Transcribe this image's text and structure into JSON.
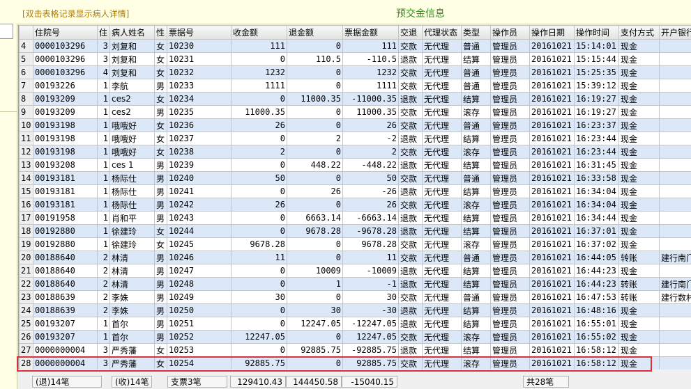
{
  "header": {
    "hint": "[双击表格记录显示病人详情]",
    "title": "预交金信息"
  },
  "columns": [
    "",
    "住院号",
    "住",
    "病人姓名",
    "性",
    "票据号",
    "收金额",
    "退金额",
    "票据金额",
    "交退",
    "代理状态",
    "类型",
    "操作员",
    "操作日期",
    "操作时间",
    "支付方式",
    "开户银行"
  ],
  "rows": [
    [
      "4",
      "0000103296",
      "3",
      "刘复和",
      "女",
      "10230",
      "111",
      "0",
      "111",
      "交款",
      "无代理",
      "普通",
      "管理员",
      "20161021",
      "15:14:01",
      "现金",
      ""
    ],
    [
      "5",
      "0000103296",
      "3",
      "刘复和",
      "女",
      "10231",
      "0",
      "110.5",
      "-110.5",
      "退款",
      "无代理",
      "结算",
      "管理员",
      "20161021",
      "15:15:44",
      "现金",
      ""
    ],
    [
      "6",
      "0000103296",
      "4",
      "刘复和",
      "女",
      "10232",
      "1232",
      "0",
      "1232",
      "交款",
      "无代理",
      "普通",
      "管理员",
      "20161021",
      "15:25:35",
      "现金",
      ""
    ],
    [
      "7",
      "00193226",
      "1",
      "李航",
      "男",
      "10233",
      "1111",
      "0",
      "1111",
      "交款",
      "无代理",
      "普通",
      "管理员",
      "20161021",
      "15:39:12",
      "现金",
      ""
    ],
    [
      "8",
      "00193209",
      "1",
      "ces2",
      "女",
      "10234",
      "0",
      "11000.35",
      "-11000.35",
      "退款",
      "无代理",
      "结算",
      "管理员",
      "20161021",
      "16:19:27",
      "现金",
      ""
    ],
    [
      "9",
      "00193209",
      "1",
      "ces2",
      "男",
      "10235",
      "11000.35",
      "0",
      "11000.35",
      "交款",
      "无代理",
      "滚存",
      "管理员",
      "20161021",
      "16:19:27",
      "现金",
      ""
    ],
    [
      "10",
      "00193198",
      "1",
      "哦哦好",
      "女",
      "10236",
      "26",
      "0",
      "26",
      "交款",
      "无代理",
      "普通",
      "管理员",
      "20161021",
      "16:23:37",
      "现金",
      ""
    ],
    [
      "11",
      "00193198",
      "1",
      "哦哦好",
      "女",
      "10237",
      "0",
      "2",
      "-2",
      "退款",
      "无代理",
      "结算",
      "管理员",
      "20161021",
      "16:23:44",
      "现金",
      ""
    ],
    [
      "12",
      "00193198",
      "1",
      "哦哦好",
      "女",
      "10238",
      "2",
      "0",
      "2",
      "交款",
      "无代理",
      "滚存",
      "管理员",
      "20161021",
      "16:23:44",
      "现金",
      ""
    ],
    [
      "13",
      "00193208",
      "1",
      "ces 1",
      "男",
      "10239",
      "0",
      "448.22",
      "-448.22",
      "退款",
      "无代理",
      "结算",
      "管理员",
      "20161021",
      "16:31:45",
      "现金",
      ""
    ],
    [
      "14",
      "00193181",
      "1",
      "杨际仕",
      "男",
      "10240",
      "50",
      "0",
      "50",
      "交款",
      "无代理",
      "普通",
      "管理员",
      "20161021",
      "16:33:58",
      "现金",
      ""
    ],
    [
      "15",
      "00193181",
      "1",
      "杨际仕",
      "男",
      "10241",
      "0",
      "26",
      "-26",
      "退款",
      "无代理",
      "结算",
      "管理员",
      "20161021",
      "16:34:04",
      "现金",
      ""
    ],
    [
      "16",
      "00193181",
      "1",
      "杨际仕",
      "男",
      "10242",
      "26",
      "0",
      "26",
      "交款",
      "无代理",
      "滚存",
      "管理员",
      "20161021",
      "16:34:04",
      "现金",
      ""
    ],
    [
      "17",
      "00191958",
      "1",
      "肖和平",
      "男",
      "10243",
      "0",
      "6663.14",
      "-6663.14",
      "退款",
      "无代理",
      "结算",
      "管理员",
      "20161021",
      "16:34:44",
      "现金",
      ""
    ],
    [
      "18",
      "00192880",
      "1",
      "徐建玲",
      "女",
      "10244",
      "0",
      "9678.28",
      "-9678.28",
      "退款",
      "无代理",
      "结算",
      "管理员",
      "20161021",
      "16:37:01",
      "现金",
      ""
    ],
    [
      "19",
      "00192880",
      "1",
      "徐建玲",
      "女",
      "10245",
      "9678.28",
      "0",
      "9678.28",
      "交款",
      "无代理",
      "滚存",
      "管理员",
      "20161021",
      "16:37:02",
      "现金",
      ""
    ],
    [
      "20",
      "00188640",
      "2",
      "林清",
      "男",
      "10246",
      "11",
      "0",
      "11",
      "交款",
      "无代理",
      "普通",
      "管理员",
      "20161021",
      "16:44:05",
      "转账",
      "建行南门"
    ],
    [
      "21",
      "00188640",
      "2",
      "林清",
      "男",
      "10247",
      "0",
      "10009",
      "-10009",
      "退款",
      "无代理",
      "结算",
      "管理员",
      "20161021",
      "16:44:23",
      "现金",
      ""
    ],
    [
      "22",
      "00188640",
      "2",
      "林清",
      "男",
      "10248",
      "0",
      "1",
      "-1",
      "退款",
      "无代理",
      "结算",
      "管理员",
      "20161021",
      "16:44:23",
      "转账",
      "建行南门"
    ],
    [
      "23",
      "00188639",
      "2",
      "李姝",
      "男",
      "10249",
      "30",
      "0",
      "30",
      "交款",
      "无代理",
      "普通",
      "管理员",
      "20161021",
      "16:47:53",
      "转账",
      "建行数村"
    ],
    [
      "24",
      "00188639",
      "2",
      "李姝",
      "男",
      "10250",
      "0",
      "30",
      "-30",
      "退款",
      "无代理",
      "结算",
      "管理员",
      "20161021",
      "16:48:16",
      "现金",
      ""
    ],
    [
      "25",
      "00193207",
      "1",
      "首尔",
      "男",
      "10251",
      "0",
      "12247.05",
      "-12247.05",
      "退款",
      "无代理",
      "结算",
      "管理员",
      "20161021",
      "16:55:01",
      "现金",
      ""
    ],
    [
      "26",
      "00193207",
      "1",
      "首尔",
      "男",
      "10252",
      "12247.05",
      "0",
      "12247.05",
      "交款",
      "无代理",
      "滚存",
      "管理员",
      "20161021",
      "16:55:02",
      "现金",
      ""
    ],
    [
      "27",
      "0000000004",
      "3",
      "严秀藩",
      "女",
      "10253",
      "0",
      "92885.75",
      "-92885.75",
      "退款",
      "无代理",
      "结算",
      "管理员",
      "20161021",
      "16:58:12",
      "现金",
      ""
    ],
    [
      "28",
      "0000000004",
      "3",
      "严秀藩",
      "女",
      "10254",
      "92885.75",
      "0",
      "92885.75",
      "交款",
      "无代理",
      "滚存",
      "管理员",
      "20161021",
      "16:58:12",
      "现金",
      ""
    ]
  ],
  "footer": {
    "refund_count": "(退)14笔",
    "receive_count": "(收)14笔",
    "cheque_count": "支票3笔",
    "total_received": "129410.43",
    "total_refunded": "144450.58",
    "total_net": "-15040.15",
    "total_count": "共28笔"
  },
  "colors": {
    "highlight_border": "#d9303a",
    "title_green": "#3a8a1e",
    "hint_orange": "#b07a00",
    "row_alt_blue": "#dce8f8"
  }
}
